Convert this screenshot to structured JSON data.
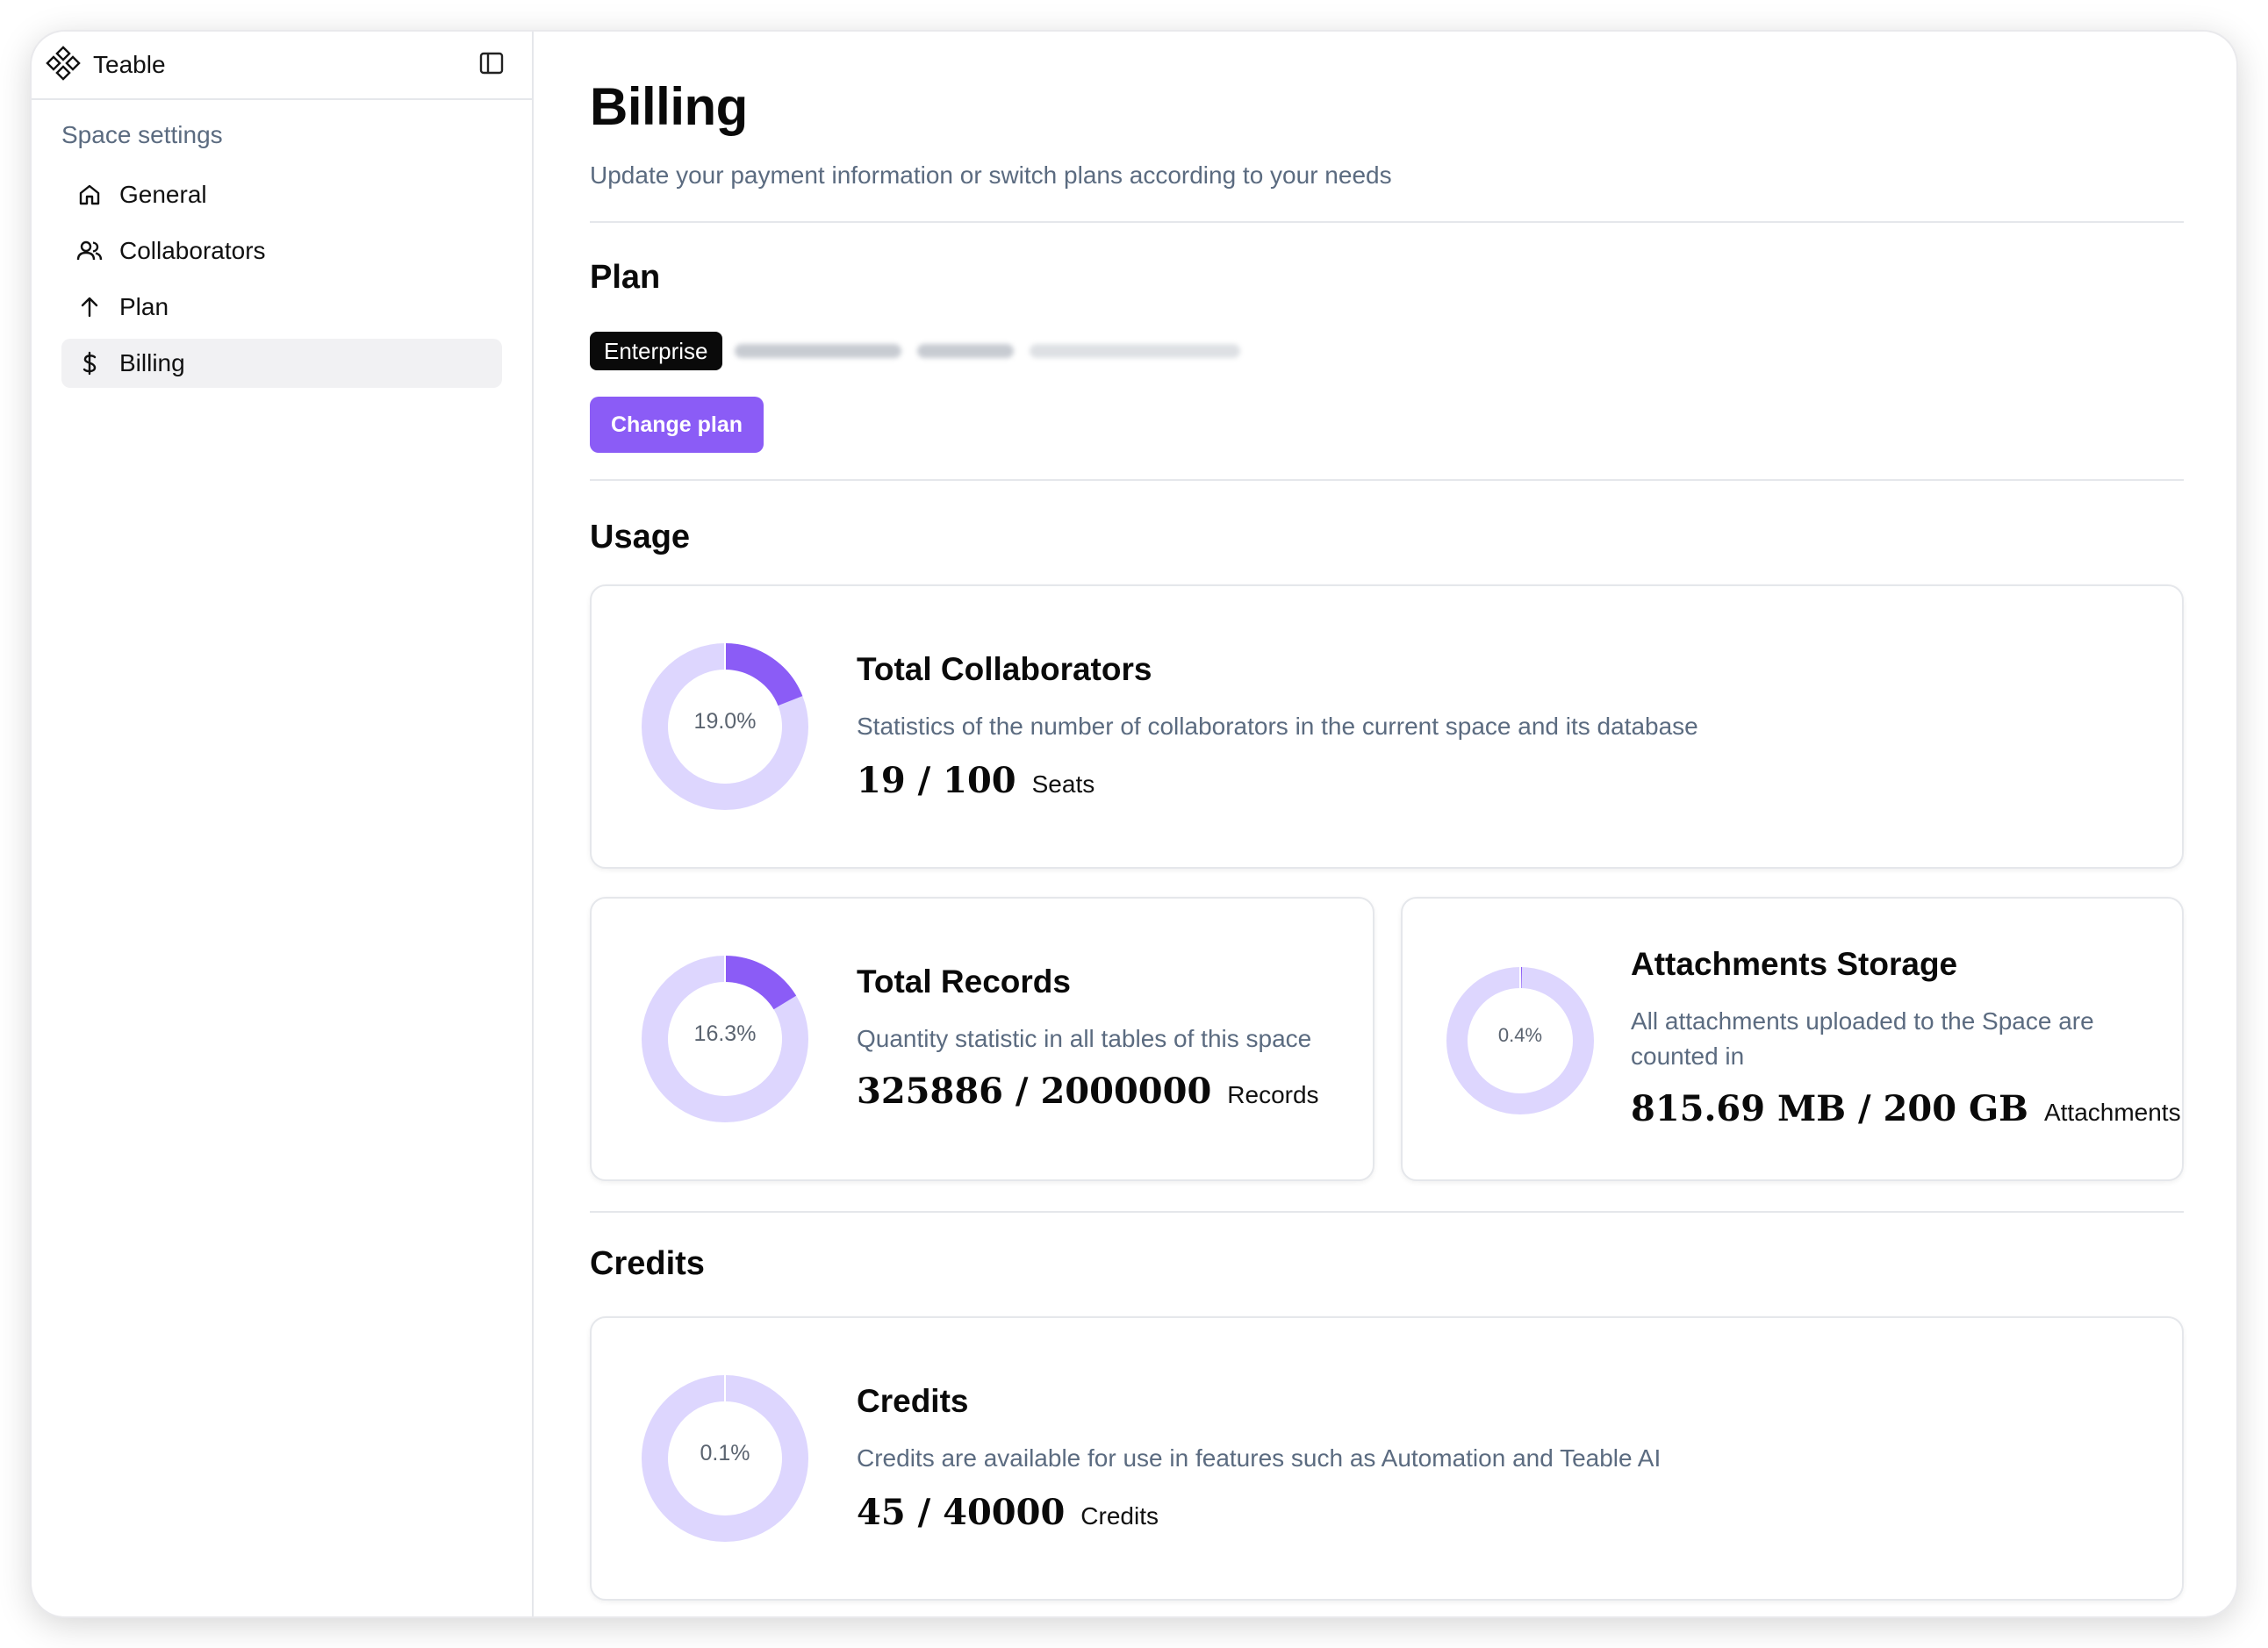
{
  "sidebar": {
    "app_name": "Teable",
    "section_title": "Space settings",
    "items": [
      {
        "label": "General",
        "icon": "home-icon"
      },
      {
        "label": "Collaborators",
        "icon": "users-icon"
      },
      {
        "label": "Plan",
        "icon": "arrow-up-icon"
      },
      {
        "label": "Billing",
        "icon": "dollar-icon",
        "active": true
      }
    ]
  },
  "header": {
    "title": "Billing",
    "subtitle": "Update your payment information or switch plans according to your needs"
  },
  "plan": {
    "heading": "Plan",
    "badge": "Enterprise",
    "change_button": "Change plan"
  },
  "usage": {
    "heading": "Usage",
    "collaborators": {
      "title": "Total Collaborators",
      "description": "Statistics of the number of collaborators in the current space and its database",
      "value": "19 / 100",
      "unit": "Seats",
      "percent_label": "19.0%",
      "percent": 0.19
    },
    "records": {
      "title": "Total Records",
      "description": "Quantity statistic in all tables of this space",
      "value": "325886 / 2000000",
      "unit": "Records",
      "percent_label": "16.3%",
      "percent": 0.163
    },
    "storage": {
      "title": "Attachments Storage",
      "description": "All attachments uploaded to the Space are counted in",
      "value": "815.69 MB / 200 GB",
      "unit": "Attachments",
      "percent_label": "0.4%",
      "percent": 0.004
    }
  },
  "credits": {
    "heading": "Credits",
    "title": "Credits",
    "description": "Credits are available for use in features such as Automation and Teable AI",
    "value": "45 / 40000",
    "unit": "Credits",
    "percent_label": "0.1%",
    "percent": 0.001
  },
  "colors": {
    "accent": "#8b5cf6",
    "track": "#ddd6fe",
    "muted_text": "#5b6b80"
  }
}
